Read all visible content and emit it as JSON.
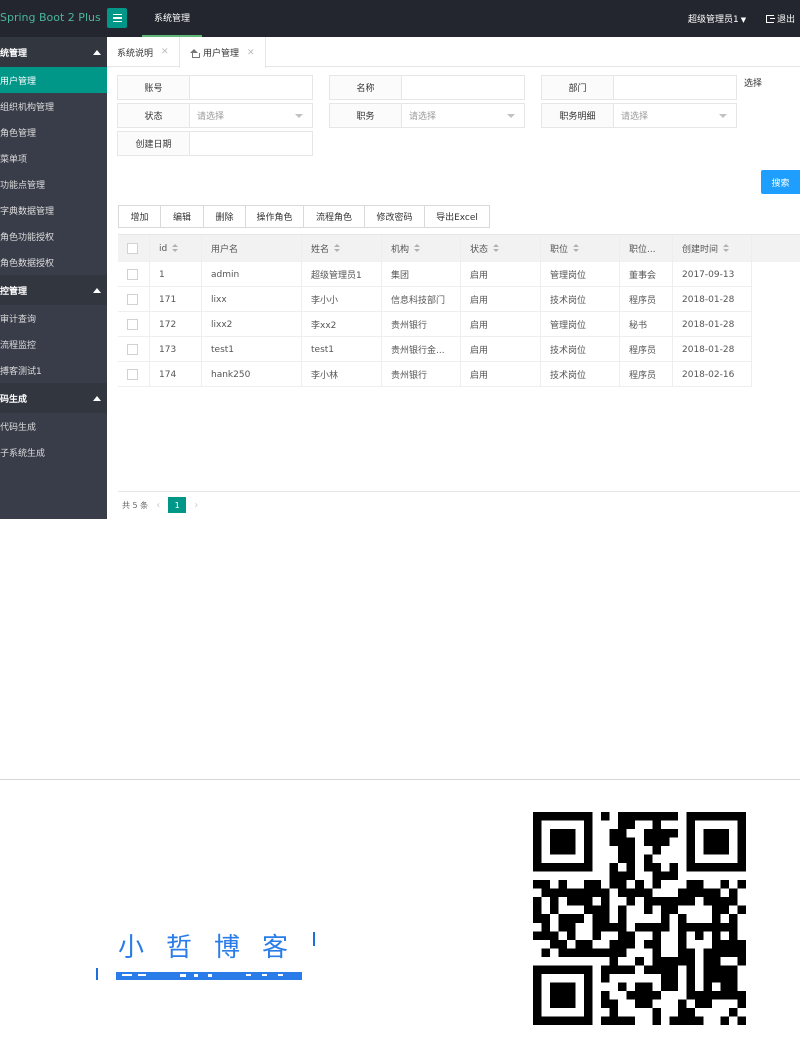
{
  "app": {
    "brand": "Spring Boot 2 Plus",
    "topnav": "系统管理",
    "user": "超级管理员1",
    "logout": "退出"
  },
  "sidebar": {
    "groups": [
      {
        "label": "统管理",
        "items": [
          "用户管理",
          "组织机构管理",
          "角色管理",
          "菜单项",
          "功能点管理",
          "字典数据管理",
          "角色功能授权",
          "角色数据授权"
        ]
      },
      {
        "label": "控管理",
        "items": [
          "审计查询",
          "流程监控",
          "搏客测试1"
        ]
      },
      {
        "label": "码生成",
        "items": [
          "代码生成",
          "子系统生成"
        ]
      }
    ]
  },
  "tabs": [
    {
      "label": "系统说明"
    },
    {
      "label": "用户管理"
    }
  ],
  "form": {
    "account_label": "账号",
    "name_label": "名称",
    "dept_label": "部门",
    "status_label": "状态",
    "status_placeholder": "请选择",
    "job_label": "职务",
    "job_placeholder": "请选择",
    "job_detail_label": "职务明细",
    "job_detail_placeholder": "请选择",
    "created_label": "创建日期",
    "select_link": "选择",
    "search_button": "搜索"
  },
  "toolbar": [
    "增加",
    "编辑",
    "删除",
    "操作角色",
    "流程角色",
    "修改密码",
    "导出Excel"
  ],
  "table": {
    "columns": [
      "id",
      "用户名",
      "姓名",
      "机构",
      "状态",
      "职位",
      "职位...",
      "创建时间"
    ],
    "rows": [
      [
        "1",
        "admin",
        "超级管理员1",
        "集团",
        "启用",
        "管理岗位",
        "董事会",
        "2017-09-13"
      ],
      [
        "171",
        "lixx",
        "李小小",
        "信息科技部门",
        "启用",
        "技术岗位",
        "程序员",
        "2018-01-28"
      ],
      [
        "172",
        "lixx2",
        "李xx2",
        "贵州银行",
        "启用",
        "管理岗位",
        "秘书",
        "2018-01-28"
      ],
      [
        "173",
        "test1",
        "test1",
        "贵州银行金...",
        "启用",
        "技术岗位",
        "程序员",
        "2018-01-28"
      ],
      [
        "174",
        "hank250",
        "李小林",
        "贵州银行",
        "启用",
        "技术岗位",
        "程序员",
        "2018-02-16"
      ]
    ]
  },
  "pager": {
    "total": "共 5 条",
    "current": "1"
  },
  "footer": {
    "blog_name": "小哲博客"
  },
  "colors": {
    "topbar": "#23262e",
    "sidebar": "#393d49",
    "accent": "#009688",
    "search": "#1e9fff"
  }
}
